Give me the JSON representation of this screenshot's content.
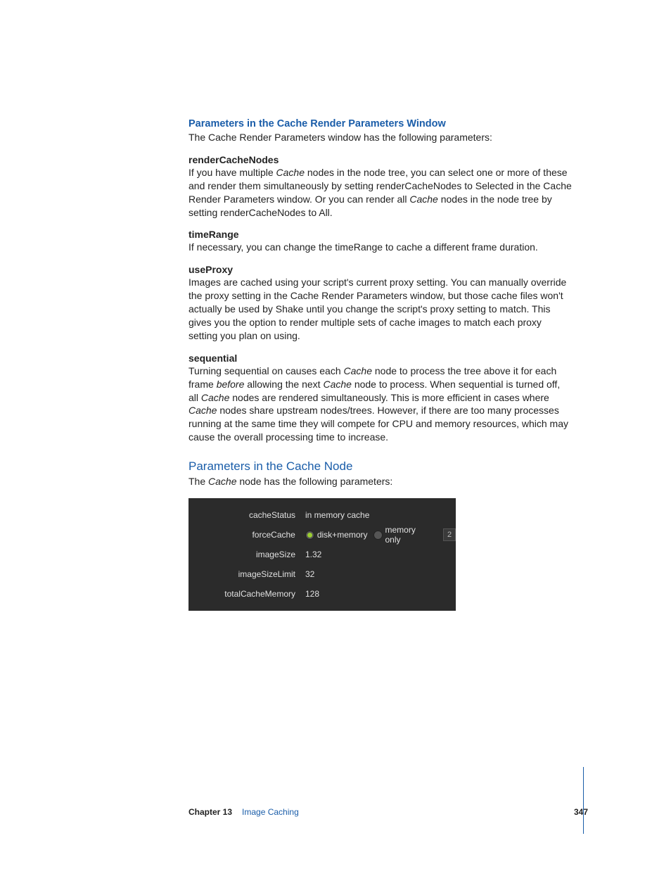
{
  "sections": {
    "renderParams": {
      "heading": "Parameters in the Cache Render Parameters Window",
      "intro": "The Cache Render Parameters window has the following parameters:"
    },
    "cacheNode": {
      "heading": "Parameters in the Cache Node",
      "intro_prefix": "The ",
      "intro_em": "Cache",
      "intro_suffix": " node has the following parameters:"
    }
  },
  "params": {
    "renderCacheNodes": {
      "name": "renderCacheNodes",
      "p1a": "If you have multiple ",
      "p1em": "Cache",
      "p1b": " nodes in the node tree, you can select one or more of these and render them simultaneously by setting renderCacheNodes to Selected in the Cache Render Parameters window. Or you can render all ",
      "p1em2": "Cache",
      "p1c": " nodes in the node tree by setting renderCacheNodes to All."
    },
    "timeRange": {
      "name": "timeRange",
      "text": "If necessary, you can change the timeRange to cache a different frame duration."
    },
    "useProxy": {
      "name": "useProxy",
      "text": "Images are cached using your script's current proxy setting. You can manually override the proxy setting in the Cache Render Parameters window, but those cache files won't actually be used by Shake until you change the script's proxy setting to match. This gives you the option to render multiple sets of cache images to match each proxy setting you plan on using."
    },
    "sequential": {
      "name": "sequential",
      "t1": "Turning sequential on causes each ",
      "em1": "Cache",
      "t2": " node to process the tree above it for each frame ",
      "em2": "before",
      "t3": " allowing the next ",
      "em3": "Cache",
      "t4": " node to process. When sequential is turned off, all ",
      "em4": "Cache",
      "t5": " nodes are rendered simultaneously. This is more efficient in cases where ",
      "em5": "Cache",
      "t6": " nodes share upstream nodes/trees. However, if there are too many processes running at the same time they will compete for CPU and memory resources, which may cause the overall processing time to increase."
    }
  },
  "panel": {
    "rows": {
      "cacheStatus": {
        "label": "cacheStatus",
        "value": "in memory cache"
      },
      "forceCache": {
        "label": "forceCache",
        "opt1": "disk+memory",
        "opt2": "memory only",
        "num": "2"
      },
      "imageSize": {
        "label": "imageSize",
        "value": "1.32"
      },
      "imageSizeLimit": {
        "label": "imageSizeLimit",
        "value": "32"
      },
      "totalCacheMemory": {
        "label": "totalCacheMemory",
        "value": "128"
      }
    }
  },
  "footer": {
    "chapter": "Chapter 13",
    "section": "Image Caching",
    "page": "347"
  }
}
